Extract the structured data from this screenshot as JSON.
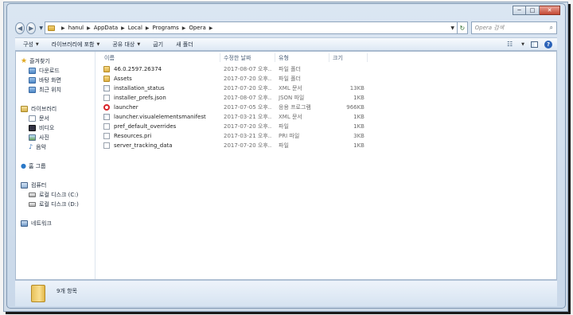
{
  "window": {
    "caption_buttons": [
      "─",
      "□",
      "✕"
    ]
  },
  "address": {
    "breadcrumbs": [
      "hanul",
      "AppData",
      "Local",
      "Programs",
      "Opera"
    ],
    "search_placeholder": "Opera 검색"
  },
  "toolbar": {
    "items": [
      {
        "label": "구성",
        "dropdown": true
      },
      {
        "label": "라이브러리에 포함",
        "dropdown": true
      },
      {
        "label": "공유 대상",
        "dropdown": true
      },
      {
        "label": "굽기",
        "dropdown": false
      },
      {
        "label": "새 폴더",
        "dropdown": false
      }
    ],
    "help_glyph": "?"
  },
  "nav": {
    "favorites": {
      "label": "즐겨찾기",
      "icon": "star-icon",
      "items": [
        {
          "label": "다운로드",
          "icon": "download-folder-icon"
        },
        {
          "label": "바탕 화면",
          "icon": "desktop-icon"
        },
        {
          "label": "최근 위치",
          "icon": "recent-places-icon"
        }
      ]
    },
    "libraries": {
      "label": "라이브러리",
      "icon": "library-icon",
      "items": [
        {
          "label": "문서",
          "icon": "documents-icon"
        },
        {
          "label": "비디오",
          "icon": "videos-icon"
        },
        {
          "label": "사진",
          "icon": "pictures-icon"
        },
        {
          "label": "음악",
          "icon": "music-icon"
        }
      ]
    },
    "homegroup": {
      "label": "홈 그룹",
      "icon": "homegroup-icon"
    },
    "computer": {
      "label": "컴퓨터",
      "icon": "computer-icon",
      "items": [
        {
          "label": "로컬 디스크 (C:)",
          "icon": "disk-icon"
        },
        {
          "label": "로컬 디스크 (D:)",
          "icon": "disk-icon"
        }
      ]
    },
    "network": {
      "label": "네트워크",
      "icon": "network-icon"
    }
  },
  "files": {
    "columns": [
      "이름",
      "수정한 날짜",
      "유형",
      "크기"
    ],
    "rows": [
      {
        "name": "46.0.2597.26374",
        "date": "2017-08-07 오후...",
        "type": "파일 폴더",
        "size": "",
        "icon": "folder"
      },
      {
        "name": "Assets",
        "date": "2017-07-20 오후...",
        "type": "파일 폴더",
        "size": "",
        "icon": "folder"
      },
      {
        "name": "installation_status",
        "date": "2017-07-20 오후...",
        "type": "XML 문서",
        "size": "13KB",
        "icon": "xml"
      },
      {
        "name": "installer_prefs.json",
        "date": "2017-08-07 오후...",
        "type": "JSON 파일",
        "size": "1KB",
        "icon": "blank"
      },
      {
        "name": "launcher",
        "date": "2017-07-05 오후...",
        "type": "응용 프로그램",
        "size": "966KB",
        "icon": "opera"
      },
      {
        "name": "launcher.visualelementsmanifest",
        "date": "2017-03-21 오후...",
        "type": "XML 문서",
        "size": "1KB",
        "icon": "xml"
      },
      {
        "name": "pref_default_overrides",
        "date": "2017-07-20 오후...",
        "type": "파일",
        "size": "1KB",
        "icon": "blank"
      },
      {
        "name": "Resources.pri",
        "date": "2017-03-21 오후...",
        "type": "PRI 파일",
        "size": "3KB",
        "icon": "blank"
      },
      {
        "name": "server_tracking_data",
        "date": "2017-07-20 오후...",
        "type": "파일",
        "size": "1KB",
        "icon": "blank"
      }
    ]
  },
  "status": {
    "item_count": "9개 항목"
  }
}
